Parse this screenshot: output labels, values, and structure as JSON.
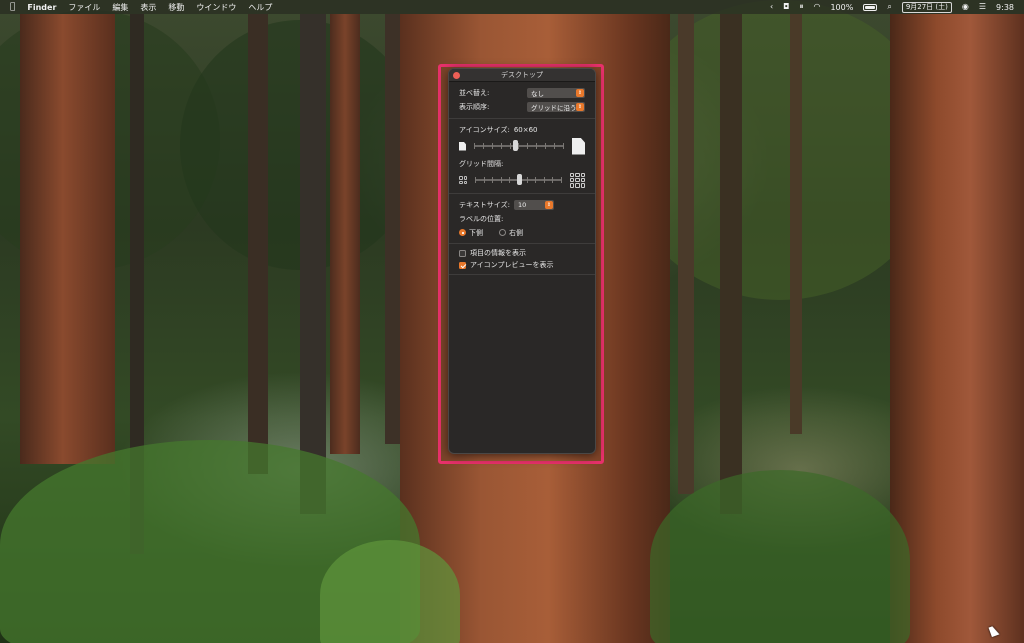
{
  "menubar": {
    "apple": "",
    "app_name": "Finder",
    "menus": [
      "ファイル",
      "編集",
      "表示",
      "移動",
      "ウインドウ",
      "ヘルプ"
    ],
    "battery": "100%",
    "date": "9月27日 (土)",
    "time": "9:38",
    "icons": [
      "chevron-left-icon",
      "app-status-icon",
      "pause-icon",
      "wifi-icon",
      "battery-icon",
      "search-icon",
      "user-icon",
      "control-center-icon"
    ]
  },
  "panel": {
    "title": "デスクトップ",
    "sort_label": "並べ替え:",
    "sort_value": "なし",
    "order_label": "表示順序:",
    "order_value": "グリッドに沿う",
    "icon_size_label": "アイコンサイズ:",
    "icon_size_value": "60×60",
    "icon_size_fraction": 0.45,
    "grid_spacing_label": "グリッド間隔:",
    "grid_spacing_fraction": 0.5,
    "text_size_label": "テキストサイズ:",
    "text_size_value": "10",
    "label_position_label": "ラベルの位置:",
    "label_bottom": "下側",
    "label_right": "右側",
    "show_item_info": "項目の情報を表示",
    "show_icon_preview": "アイコンプレビューを表示",
    "show_item_info_checked": false,
    "show_icon_preview_checked": true
  },
  "colors": {
    "accent": "#e8782b",
    "highlight": "#e8316b",
    "panel_bg": "#2a2827"
  }
}
